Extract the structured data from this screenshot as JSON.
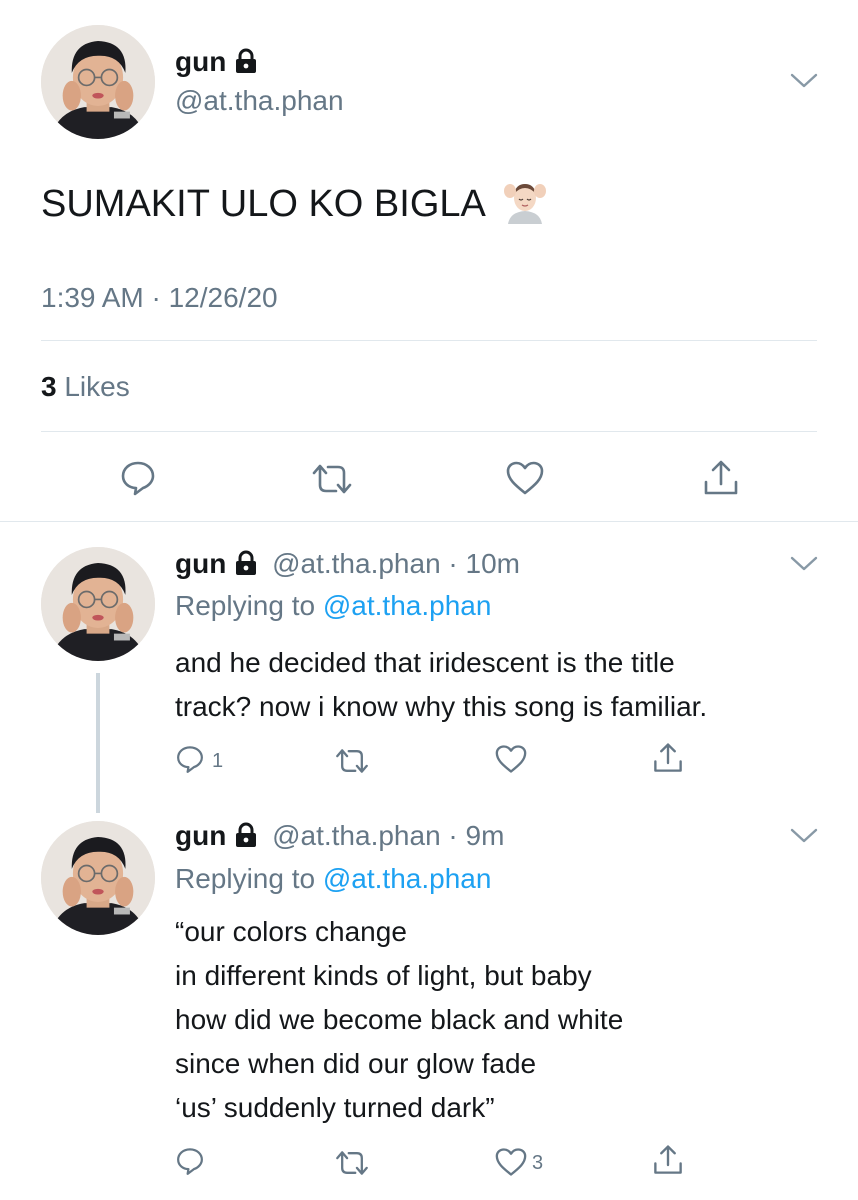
{
  "main_tweet": {
    "display_name": "gun",
    "handle": "@at.tha.phan",
    "text": "SUMAKIT ULO KO BIGLA",
    "emoji": "💆🏻",
    "time": "1:39 AM · 12/26/20",
    "likes_count": "3",
    "likes_label": "Likes"
  },
  "replies": [
    {
      "display_name": "gun",
      "handle": "@at.tha.phan",
      "time": "10m",
      "replying_prefix": "Replying to",
      "replying_to": "@at.tha.phan",
      "lines": [
        "and he decided that iridescent is the title",
        "track? now i know why this song is familiar."
      ],
      "reply_count": "1",
      "like_count": ""
    },
    {
      "display_name": "gun",
      "handle": "@at.tha.phan",
      "time": "9m",
      "replying_prefix": "Replying to",
      "replying_to": "@at.tha.phan",
      "lines": [
        "“our colors change",
        "in different kinds of light, but baby",
        "how did we become black and white",
        "since when did our glow fade",
        "‘us’ suddenly turned dark”"
      ],
      "reply_count": "",
      "like_count": "3"
    }
  ],
  "icons": {
    "lock": "lock-icon",
    "chevron": "chevron-down-icon",
    "reply": "reply-icon",
    "retweet": "retweet-icon",
    "like": "heart-icon",
    "share": "share-icon"
  },
  "colors": {
    "text": "#14171a",
    "secondary": "#657786",
    "link": "#1da1f2",
    "divider": "#e1e8ed"
  }
}
